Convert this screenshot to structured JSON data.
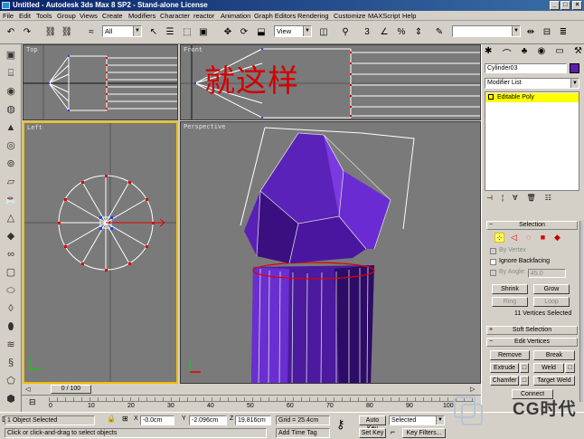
{
  "window": {
    "title": "Untitled - Autodesk 3ds Max 8 SP2 - Stand-alone License"
  },
  "menu": [
    "File",
    "Edit",
    "Tools",
    "Group",
    "Views",
    "Create",
    "Modifiers",
    "Character",
    "reactor",
    "Animation",
    "Graph Editors",
    "Rendering",
    "Customize",
    "MAXScript",
    "Help"
  ],
  "toolbar": {
    "selection_filter": "All",
    "ref_coord": "View"
  },
  "viewports": {
    "top": "Top",
    "front": "Front",
    "left": "Left",
    "perspective": "Perspective",
    "overlay_text": "就这样"
  },
  "time": {
    "slider_label": "0 / 100",
    "ticks": [
      "0",
      "10",
      "20",
      "30",
      "40",
      "50",
      "60",
      "70",
      "80",
      "90",
      "100"
    ]
  },
  "status": {
    "selected": "1 Object Selected",
    "prompt": "Click or click-and-drag to select objects",
    "x": "-0.0cm",
    "y": "-2.096cm",
    "z": "19.816cm",
    "y_label": "Y",
    "z_label": "Z",
    "grid": "Grid = 25.4cm",
    "add_time_tag": "Add Time Tag",
    "auto_key": "Auto Key",
    "set_key": "Set Key",
    "key_mode": "Selected",
    "key_filters": "Key Filters..."
  },
  "command_panel": {
    "object_name": "Cylinder03",
    "object_color": "#5a1fa8",
    "modifier_list": "Modifier List",
    "stack_item": "Editable Poly",
    "selection": {
      "title": "Selection",
      "by_vertex": "By Vertex",
      "ignore_backfacing": "Ignore Backfacing",
      "by_angle": "By Angle:",
      "angle_value": "45.0",
      "shrink": "Shrink",
      "grow": "Grow",
      "ring": "Ring",
      "loop": "Loop",
      "status": "11 Vertices Selected"
    },
    "soft_selection": {
      "title": "Soft Selection"
    },
    "edit_vertices": {
      "title": "Edit Vertices",
      "remove": "Remove",
      "break": "Break",
      "extrude": "Extrude",
      "weld": "Weld",
      "chamfer": "Chamfer",
      "target_weld": "Target Weld",
      "connect": "Connect"
    }
  },
  "watermark": {
    "text": "CG时代"
  },
  "colors": {
    "title_bar": "#0a246a",
    "viewport_bg": "#7a7a7a",
    "object": "#5a1fa8",
    "active_border": "#f0c000",
    "stack_highlight": "#ffff00"
  }
}
